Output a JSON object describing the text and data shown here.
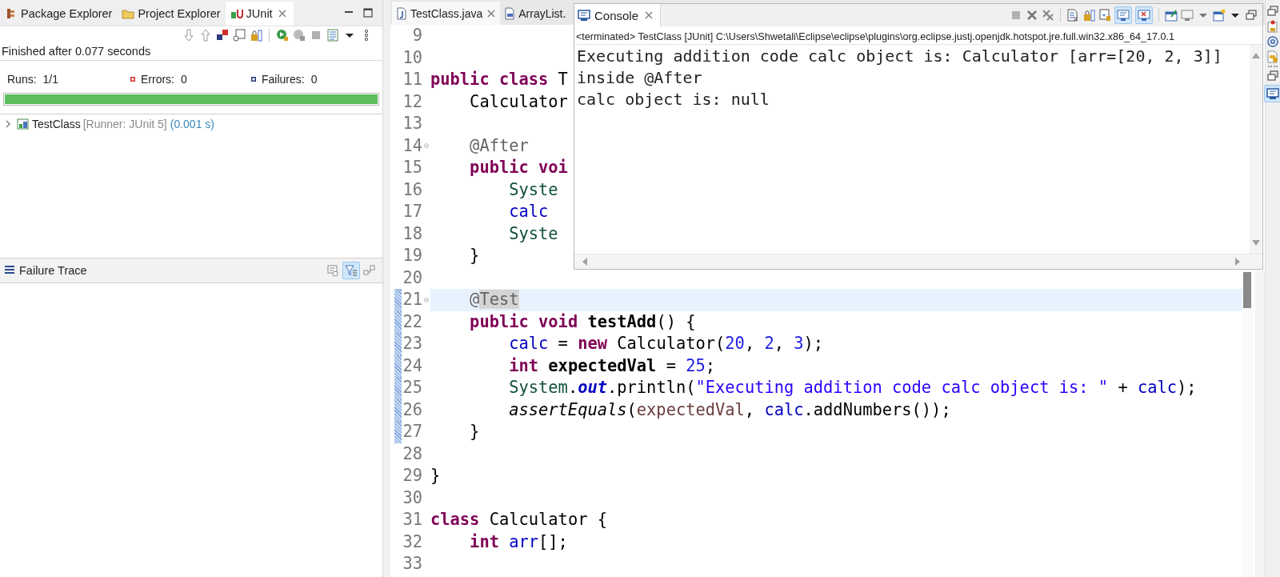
{
  "junit_view": {
    "tabs": [
      {
        "label": "Package Explorer",
        "selected": false,
        "closable": false,
        "kind": "package"
      },
      {
        "label": "Project Explorer",
        "selected": false,
        "closable": false,
        "kind": "project"
      },
      {
        "label": "JUnit",
        "selected": true,
        "closable": true,
        "kind": "junit"
      }
    ],
    "status": "Finished after 0.077 seconds",
    "counters": [
      {
        "kind": "runs",
        "label": "Runs:",
        "value": "1/1"
      },
      {
        "kind": "errors",
        "label": "Errors:",
        "value": "0"
      },
      {
        "kind": "failures",
        "label": "Failures:",
        "value": "0"
      }
    ],
    "progress": {
      "level": 1.0
    },
    "tree": [
      {
        "name": "TestClass",
        "runner": "[Runner: JUnit 5]",
        "time": "(0.001 s)",
        "expanded": false
      }
    ],
    "failure_trace": {
      "title": "Failure Trace",
      "filter": {
        "pressed": true
      }
    }
  },
  "editor": {
    "tabs": [
      {
        "label": "TestClass.java",
        "selected": true,
        "closable": true,
        "kind": "java"
      },
      {
        "label": "ArrayList.",
        "selected": false,
        "closable": false,
        "kind": "class"
      }
    ],
    "lines": [
      {
        "number": "9",
        "current": false,
        "foldable": false,
        "in_range": false
      },
      {
        "number": "10",
        "current": false,
        "foldable": false,
        "in_range": false
      },
      {
        "number": "11",
        "current": false,
        "foldable": false,
        "in_range": false,
        "tokens": [
          {
            "text": "public ",
            "kind": "keyword"
          },
          {
            "text": "class",
            "kind": "keyword"
          },
          {
            "text": " T",
            "kind": "plain"
          }
        ]
      },
      {
        "number": "12",
        "current": false,
        "foldable": false,
        "in_range": false,
        "tokens": [
          {
            "text": "    Calculator",
            "kind": "plain"
          }
        ]
      },
      {
        "number": "13",
        "current": false,
        "foldable": false,
        "in_range": false
      },
      {
        "number": "14",
        "current": false,
        "foldable": true,
        "in_range": false,
        "tokens": [
          {
            "text": "    @After",
            "kind": "annotation"
          }
        ]
      },
      {
        "number": "15",
        "current": false,
        "foldable": false,
        "in_range": false,
        "tokens": [
          {
            "text": "    public ",
            "kind": "keyword"
          },
          {
            "text": "voi",
            "kind": "keyword"
          }
        ]
      },
      {
        "number": "16",
        "current": false,
        "foldable": false,
        "in_range": false,
        "tokens": [
          {
            "text": "        Syste",
            "kind": "type"
          }
        ]
      },
      {
        "number": "17",
        "current": false,
        "foldable": false,
        "in_range": false,
        "tokens": [
          {
            "text": "        calc",
            "kind": "field"
          }
        ]
      },
      {
        "number": "18",
        "current": false,
        "foldable": false,
        "in_range": false,
        "tokens": [
          {
            "text": "        Syste",
            "kind": "type"
          }
        ]
      },
      {
        "number": "19",
        "current": false,
        "foldable": false,
        "in_range": false,
        "tokens": [
          {
            "text": "    }",
            "kind": "plain"
          }
        ]
      },
      {
        "number": "20",
        "current": false,
        "foldable": false,
        "in_range": false
      },
      {
        "number": "21",
        "current": true,
        "foldable": true,
        "in_range": true,
        "tokens": [
          {
            "text": "    @",
            "kind": "annotation"
          },
          {
            "text": "Test",
            "kind": "occurrence"
          }
        ]
      },
      {
        "number": "22",
        "current": false,
        "foldable": false,
        "in_range": true,
        "tokens": [
          {
            "text": "    public ",
            "kind": "keyword"
          },
          {
            "text": "void ",
            "kind": "keyword"
          },
          {
            "text": "testAdd",
            "kind": "decl"
          },
          {
            "text": "() {",
            "kind": "plain"
          }
        ]
      },
      {
        "number": "23",
        "current": false,
        "foldable": false,
        "in_range": true,
        "tokens": [
          {
            "text": "        calc",
            "kind": "field"
          },
          {
            "text": " = ",
            "kind": "plain"
          },
          {
            "text": "new",
            "kind": "keyword"
          },
          {
            "text": " Calculator(",
            "kind": "plain"
          },
          {
            "text": "20",
            "kind": "number"
          },
          {
            "text": ", ",
            "kind": "plain"
          },
          {
            "text": "2",
            "kind": "number"
          },
          {
            "text": ", ",
            "kind": "plain"
          },
          {
            "text": "3",
            "kind": "number"
          },
          {
            "text": ");",
            "kind": "plain"
          }
        ]
      },
      {
        "number": "24",
        "current": false,
        "foldable": false,
        "in_range": true,
        "tokens": [
          {
            "text": "        int ",
            "kind": "keyword"
          },
          {
            "text": "expectedVal",
            "kind": "decl"
          },
          {
            "text": " = ",
            "kind": "plain"
          },
          {
            "text": "25",
            "kind": "number"
          },
          {
            "text": ";",
            "kind": "plain"
          }
        ]
      },
      {
        "number": "25",
        "current": false,
        "foldable": false,
        "in_range": true,
        "tokens": [
          {
            "text": "        System",
            "kind": "type"
          },
          {
            "text": ".",
            "kind": "plain"
          },
          {
            "text": "out",
            "kind": "static-field"
          },
          {
            "text": ".println(",
            "kind": "plain"
          },
          {
            "text": "\"Executing addition code calc object is: \"",
            "kind": "string"
          },
          {
            "text": " + ",
            "kind": "plain"
          },
          {
            "text": "calc",
            "kind": "field"
          },
          {
            "text": ");",
            "kind": "plain"
          }
        ]
      },
      {
        "number": "26",
        "current": false,
        "foldable": false,
        "in_range": true,
        "tokens": [
          {
            "text": "        assertEquals",
            "kind": "static-method"
          },
          {
            "text": "(",
            "kind": "plain"
          },
          {
            "text": "expectedVal",
            "kind": "local"
          },
          {
            "text": ", ",
            "kind": "plain"
          },
          {
            "text": "calc",
            "kind": "field"
          },
          {
            "text": ".addNumbers());",
            "kind": "plain"
          }
        ]
      },
      {
        "number": "27",
        "current": false,
        "foldable": false,
        "in_range": true,
        "tokens": [
          {
            "text": "    }",
            "kind": "plain"
          }
        ]
      },
      {
        "number": "28",
        "current": false,
        "foldable": false,
        "in_range": false
      },
      {
        "number": "29",
        "current": false,
        "foldable": false,
        "in_range": false,
        "tokens": [
          {
            "text": "}",
            "kind": "plain"
          }
        ]
      },
      {
        "number": "30",
        "current": false,
        "foldable": false,
        "in_range": false
      },
      {
        "number": "31",
        "current": false,
        "foldable": false,
        "in_range": false,
        "tokens": [
          {
            "text": "class",
            "kind": "keyword"
          },
          {
            "text": " Calculator {",
            "kind": "plain"
          }
        ]
      },
      {
        "number": "32",
        "current": false,
        "foldable": false,
        "in_range": false,
        "tokens": [
          {
            "text": "    int ",
            "kind": "keyword"
          },
          {
            "text": "arr",
            "kind": "field"
          },
          {
            "text": "[];",
            "kind": "plain"
          }
        ]
      },
      {
        "number": "33",
        "current": false,
        "foldable": false,
        "in_range": false
      }
    ]
  },
  "console": {
    "title": "Console",
    "closable": true,
    "header": "<terminated> TestClass [JUnit] C:\\Users\\Shwetali\\Eclipse\\eclipse\\plugins\\org.eclipse.justj.openjdk.hotspot.jre.full.win32.x86_64_17.0.1",
    "output": [
      "Executing addition code calc object is: Calculator [arr=[20, 2, 3]]",
      "inside @After",
      "calc object is: null"
    ],
    "stdout_toggle": {
      "pressed": true
    },
    "stderr_toggle": {
      "pressed": true
    }
  },
  "side_bar": {
    "console_button": {
      "pressed": true
    }
  }
}
